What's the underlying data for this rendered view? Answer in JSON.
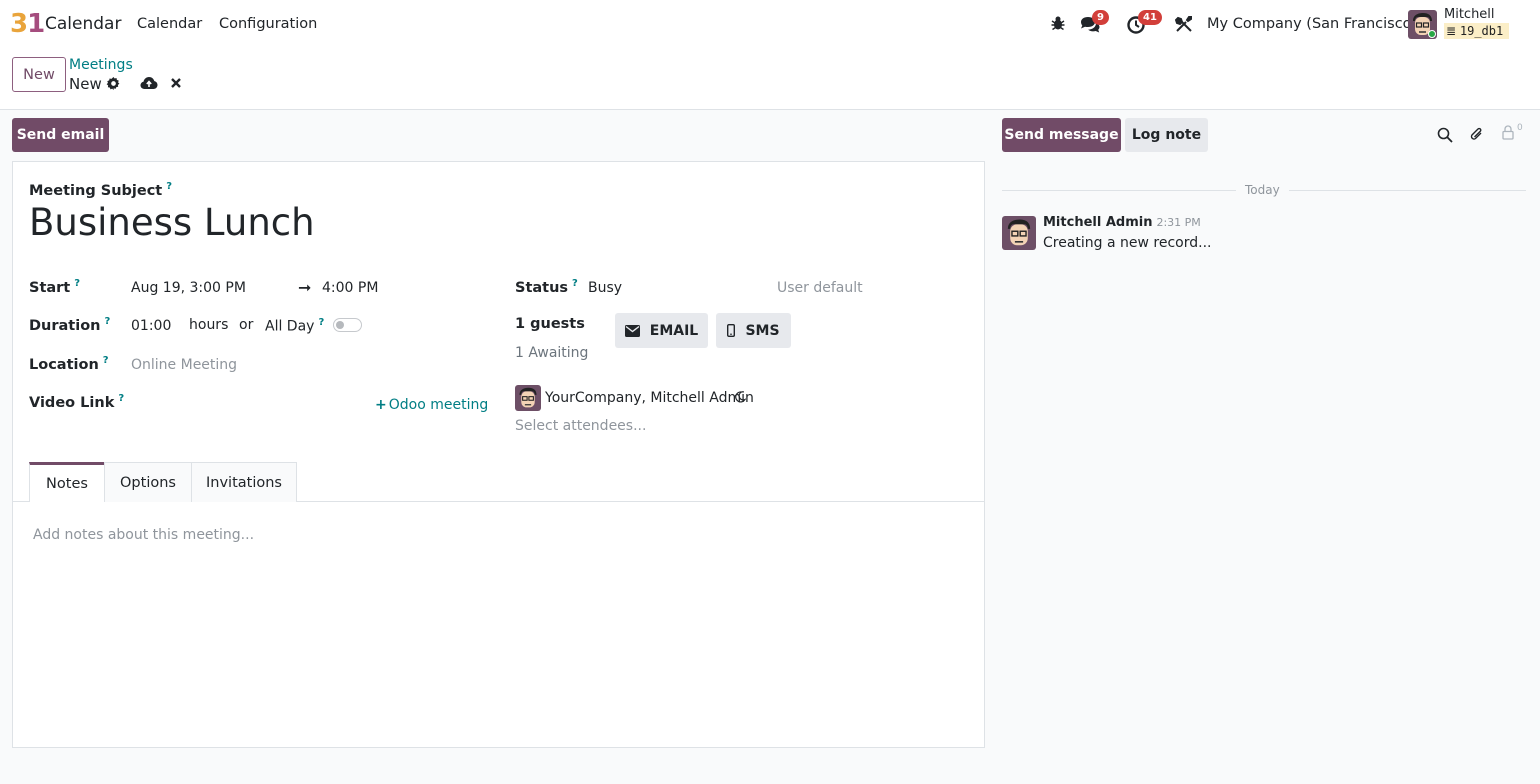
{
  "navbar": {
    "app_logo_digit1": "3",
    "app_logo_digit2": "1",
    "app_name": "Calendar",
    "menu": [
      "Calendar",
      "Configuration"
    ],
    "messages_count": "9",
    "activities_count": "41",
    "company": "My Company (San Francisco)",
    "user_name": "Mitchell Admin",
    "database": "19_db1"
  },
  "control_panel": {
    "new_label": "New",
    "breadcrumb_parent": "Meetings",
    "breadcrumb_current": "New"
  },
  "actions": {
    "send_email_label": "Send email"
  },
  "form": {
    "subject_label": "Meeting Subject",
    "help_mark": "?",
    "subject_value": "Business Lunch",
    "start_label": "Start",
    "start_value": "Aug 19, 3:00 PM",
    "arrow": "➞",
    "end_value": "4:00 PM",
    "duration_label": "Duration",
    "duration_value": "01:00",
    "duration_unit": "hours",
    "or_text": "or",
    "allday_label": "All Day",
    "allday_checked": false,
    "location_label": "Location",
    "location_placeholder": "Online Meeting",
    "videolink_label": "Video Link",
    "odoo_meeting_label": "Odoo meeting",
    "status_label": "Status",
    "status_value": "Busy",
    "privacy_value": "User default",
    "guests_count": "1 guests",
    "awaiting_text": "1 Awaiting",
    "email_btn": "EMAIL",
    "sms_btn": "SMS",
    "attendee_name": "YourCompany, Mitchell Admin",
    "attendees_placeholder": "Select attendees...",
    "tabs": [
      "Notes",
      "Options",
      "Invitations"
    ],
    "notes_placeholder": "Add notes about this meeting..."
  },
  "chatter": {
    "send_message_label": "Send message",
    "log_note_label": "Log note",
    "followers_count": "0",
    "date_separator": "Today",
    "messages": [
      {
        "author": "Mitchell Admin",
        "time": "2:31 PM",
        "body": "Creating a new record..."
      }
    ]
  },
  "colors": {
    "primary": "#714b67",
    "link": "#017e84",
    "badge": "#d23f3a"
  }
}
